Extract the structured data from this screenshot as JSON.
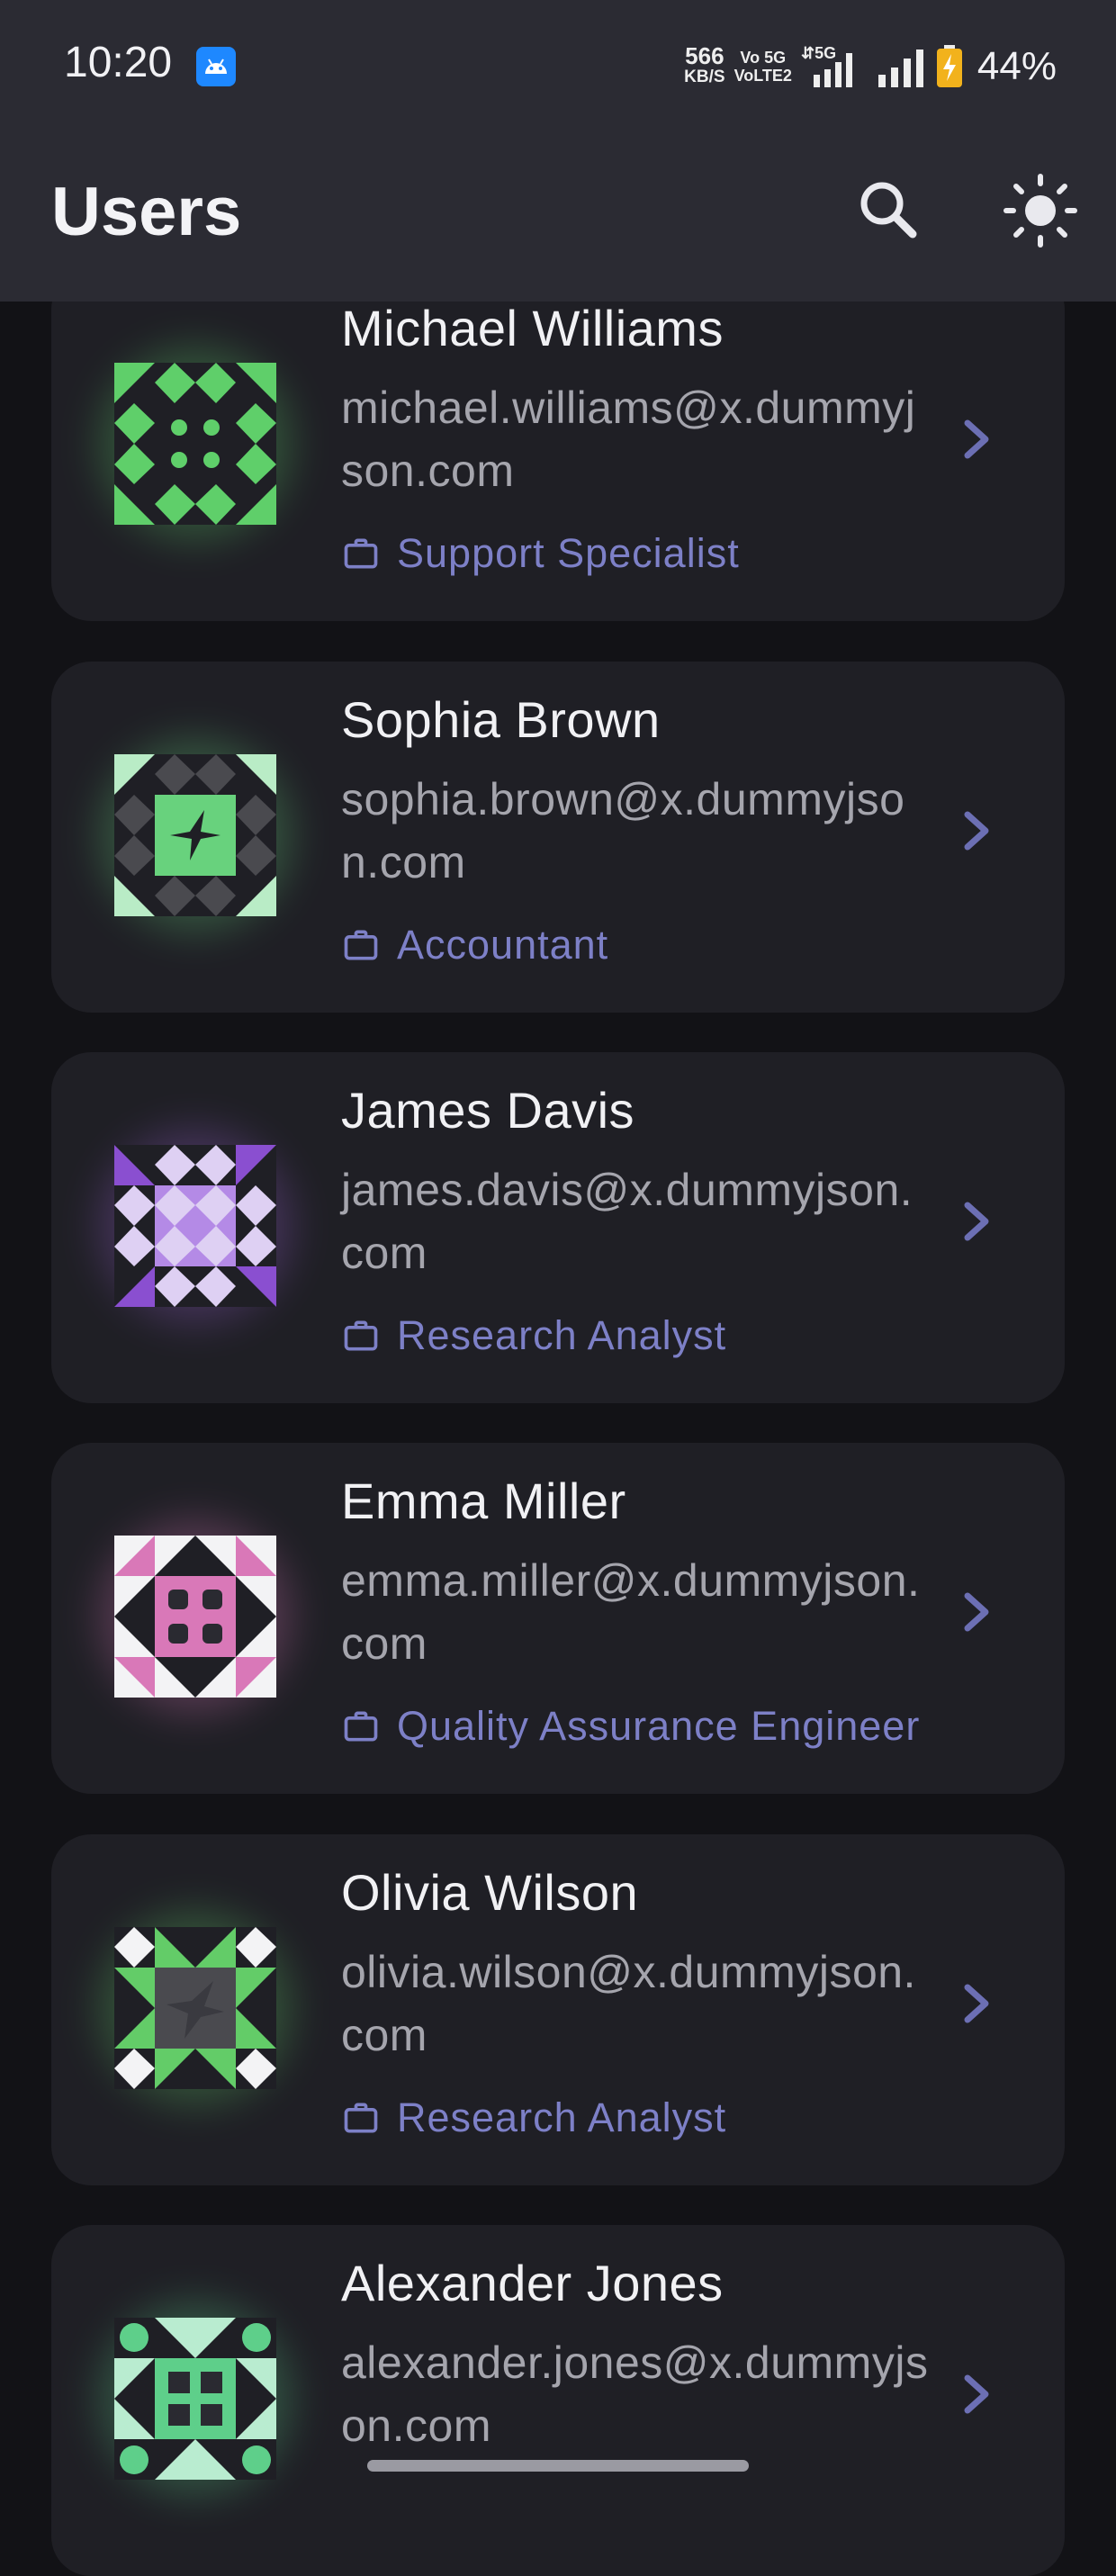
{
  "status_bar": {
    "time": "10:20",
    "net_speed": "566",
    "net_unit": "KB/S",
    "volte_top": "Vo 5G",
    "volte_bottom": "VoLTE2",
    "signal_label": "5G",
    "battery": "44%"
  },
  "app_bar": {
    "title": "Users",
    "search_icon": "search-icon",
    "theme_icon": "sun-icon"
  },
  "users": [
    {
      "name": "Michael Williams",
      "email": "michael.williams@x.dummyjson.com",
      "role": "Support Specialist",
      "color": "#5fcf6a"
    },
    {
      "name": "Sophia Brown",
      "email": "sophia.brown@x.dummyjson.com",
      "role": "Accountant",
      "color": "#68d27d"
    },
    {
      "name": "James Davis",
      "email": "james.davis@x.dummyjson.com",
      "role": "Research Analyst",
      "color": "#9d63d6"
    },
    {
      "name": "Emma Miller",
      "email": "emma.miller@x.dummyjson.com",
      "role": "Quality Assurance Engineer",
      "color": "#d978b8"
    },
    {
      "name": "Olivia Wilson",
      "email": "olivia.wilson@x.dummyjson.com",
      "role": "Research Analyst",
      "color": "#63cc68"
    },
    {
      "name": "Alexander Jones",
      "email": "alexander.jones@x.dummyjson.com",
      "role": "",
      "color": "#5ecf8a"
    }
  ],
  "colors": {
    "background": "#121216",
    "card": "#1f1f25",
    "header": "#2b2b33",
    "role_text": "#7d80c7",
    "chevron": "#6c6fb4"
  }
}
